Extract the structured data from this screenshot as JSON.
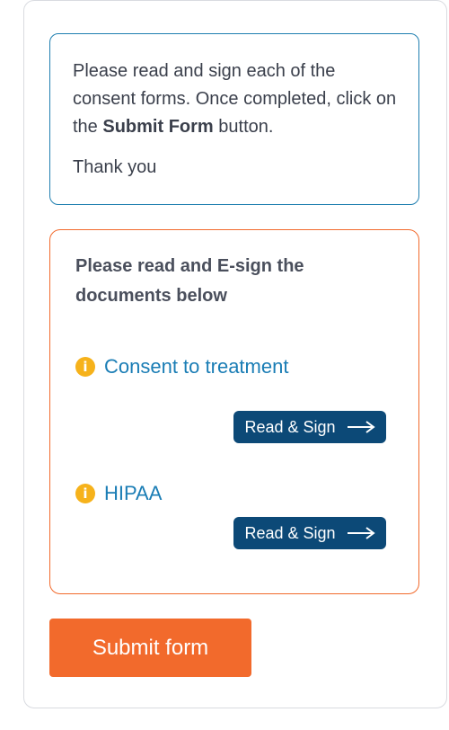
{
  "info": {
    "text_before": "Please read and sign each of the consent forms. Once completed, click on the ",
    "bold": "Submit Form",
    "text_after": " button.",
    "thanks": "Thank you"
  },
  "documents": {
    "heading": "Please read and E-sign the documents below",
    "items": [
      {
        "label": "Consent to treatment",
        "icon": "info-icon",
        "button_label": "Read & Sign",
        "button_icon": "arrow-right-icon"
      },
      {
        "label": "HIPAA",
        "icon": "info-icon",
        "button_label": "Read & Sign",
        "button_icon": "arrow-right-icon"
      }
    ]
  },
  "submit": {
    "label": "Submit form"
  },
  "colors": {
    "info_border": "#1f7fb0",
    "docs_border": "#f26a2c",
    "link": "#1a7db5",
    "button": "#0c4977",
    "submit": "#f26a2c",
    "icon": "#f6b21b"
  }
}
